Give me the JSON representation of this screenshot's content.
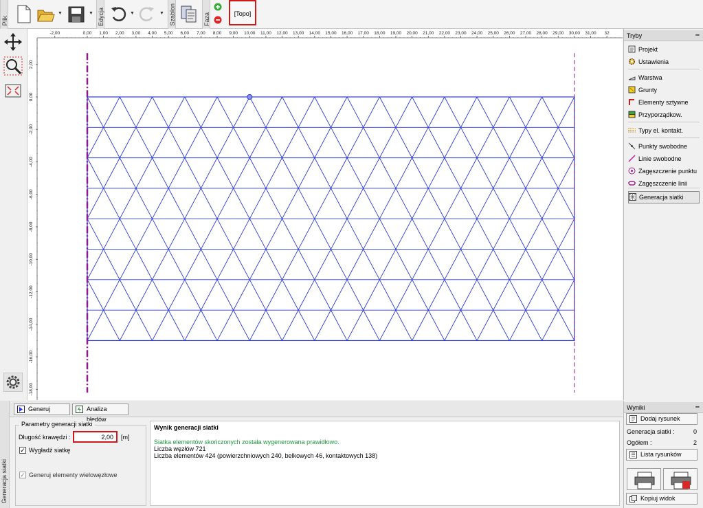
{
  "toolbar": {
    "file_label": "Plik",
    "edit_label": "Edycja",
    "template_label": "Szablon",
    "phase_label": "Faza",
    "phase_name": "[Topo]",
    "icons": {
      "new": "new-file-icon",
      "open": "open-folder-icon",
      "save": "save-icon",
      "undo": "undo-icon",
      "redo": "redo-icon",
      "template": "copy-template-icon",
      "phase_add": "plus-icon",
      "phase_remove": "minus-icon"
    }
  },
  "left_tools": {
    "icons": [
      "move-icon",
      "zoom-icon",
      "fit-view-icon",
      "settings-gear-icon"
    ]
  },
  "ruler": {
    "unit": "[m]",
    "x_ticks": [
      "-2,00",
      "0,00",
      "1,00",
      "2,00",
      "3,00",
      "4,00",
      "5,00",
      "6,00",
      "7,00",
      "8,00",
      "9,00",
      "10,00",
      "11,00",
      "12,00",
      "13,00",
      "14,00",
      "15,00",
      "16,00",
      "17,00",
      "18,00",
      "19,00",
      "20,00",
      "21,00",
      "22,00",
      "23,00",
      "24,00",
      "25,00",
      "26,00",
      "27,00",
      "28,00",
      "29,00",
      "30,00",
      "31,00",
      "32"
    ],
    "y_ticks": [
      "2,00",
      "0,00",
      "-2,00",
      "-4,00",
      "-6,00",
      "-8,00",
      "-10,00",
      "-12,00",
      "-14,00",
      "-16,00",
      "-18,00"
    ]
  },
  "mesh": {
    "x_min": 0,
    "x_max": 30,
    "y_top": 0,
    "y_bottom": -15,
    "edge_length": 2,
    "color": "#2a3ad6",
    "boundary_color": "#8b1a8b"
  },
  "right_panel": {
    "header": "Tryby",
    "modes": [
      {
        "label": "Projekt",
        "icon": "project-icon"
      },
      {
        "label": "Ustawienia",
        "icon": "settings-icon"
      },
      {
        "label": "Warstwa",
        "icon": "layer-icon"
      },
      {
        "label": "Grunty",
        "icon": "soil-icon"
      },
      {
        "label": "Elementy sztywne",
        "icon": "rigid-element-icon"
      },
      {
        "label": "Przyporządkow.",
        "icon": "assign-icon"
      },
      {
        "label": "Typy el. kontakt.",
        "icon": "contact-type-icon"
      },
      {
        "label": "Punkty swobodne",
        "icon": "free-point-icon"
      },
      {
        "label": "Linie swobodne",
        "icon": "free-line-icon"
      },
      {
        "label": "Zagęszczenie punktu",
        "icon": "point-refine-icon"
      },
      {
        "label": "Zagęszczenie linii",
        "icon": "line-refine-icon"
      },
      {
        "label": "Generacja siatki",
        "icon": "mesh-generation-icon"
      }
    ]
  },
  "bottom_panel": {
    "vertical_label": "Generacja siatki",
    "tabs": [
      {
        "label": "Generuj",
        "icon": "generate-icon"
      },
      {
        "label": "Analiza błędów",
        "icon": "error-analysis-icon"
      }
    ],
    "params": {
      "title": "Parametry generacji siatki",
      "edge_length_label": "Długość krawędzi :",
      "edge_length_value": "2,00",
      "edge_length_unit": "[m]",
      "smooth_label": "Wygładź siatkę",
      "multinode_label": "Generuj elementy wielowęzłowe"
    },
    "result": {
      "title": "Wynik generacji siatki",
      "success": "Siatka elementów skończonych została wygenerowana prawidłowo.",
      "nodes": "Liczba węzłów 721",
      "elements": "Liczba elementów 424 (powierzchniowych 240, belkowych 46, kontaktowych 138)"
    }
  },
  "results_panel": {
    "header": "Wyniki",
    "add_drawing": "Dodaj rysunek",
    "mesh_gen_label": "Generacja siatki :",
    "mesh_gen_count": "0",
    "total_label": "Ogółem :",
    "total_count": "2",
    "drawing_list": "Lista rysunków",
    "copy_view": "Kopiuj widok",
    "icons": [
      "print-icon",
      "print-pdf-icon"
    ]
  }
}
